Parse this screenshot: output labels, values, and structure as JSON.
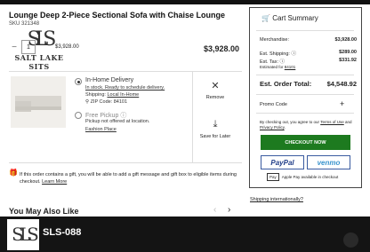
{
  "product": {
    "title": "Lounge Deep 2-Piece Sectional Sofa with Chaise Lounge",
    "sku": "SKU 321348",
    "quantity": "1",
    "unit_price": "$3,928.00",
    "price": "$3,928.00"
  },
  "brand": {
    "monogram": "SLS",
    "name": "SALT LAKE SITS"
  },
  "delivery": {
    "inhome_title": "In-Home Delivery",
    "inhome_status": "In stock. Ready to schedule delivery.",
    "shipping_label": "Shipping:",
    "shipping_link": "Local In-Home",
    "zip": "ZIP Code: 84101",
    "pickup_title": "Free Pickup",
    "pickup_note": "Pickup not offered at location.",
    "pickup_link": "Fashion Place"
  },
  "actions": {
    "remove": "Remove",
    "save_later": "Save for Later"
  },
  "gift": {
    "text": "If this order contains a gift, you will be able to add a gift message and gift box to eligible items during checkout.",
    "link": "Learn More"
  },
  "recommendations": {
    "title": "You May Also Like"
  },
  "summary": {
    "title": "Cart Summary",
    "merch_label": "Merchandise:",
    "merch_val": "$3,928.00",
    "ship_label": "Est. Shipping:",
    "ship_val": "$289.00",
    "tax_label": "Est. Tax:",
    "tax_val": "$331.92",
    "tax_note": "Estimated for",
    "tax_zip": "84101",
    "total_label": "Est. Order Total:",
    "total_val": "$4,548.92",
    "promo_label": "Promo Code",
    "terms_a": "By checking out, you agree to our",
    "terms_link1": "Terms of Use",
    "terms_and": "and",
    "terms_link2": "Privacy Policy",
    "checkout_label": "CHECKOUT NOW",
    "paypal_label": "PayPal",
    "venmo_label": "venmo",
    "applepay_badge": "Pay",
    "applepay_text": "Apple Pay available in checkout",
    "intl_link": "Shipping internationally?"
  },
  "footer": {
    "monogram": "SLS",
    "label": "SLS-088"
  },
  "colors": {
    "accent": "#1d7a1f",
    "paypal": "#1f3c88",
    "venmo": "#3d95ce",
    "footer": "#141414"
  }
}
